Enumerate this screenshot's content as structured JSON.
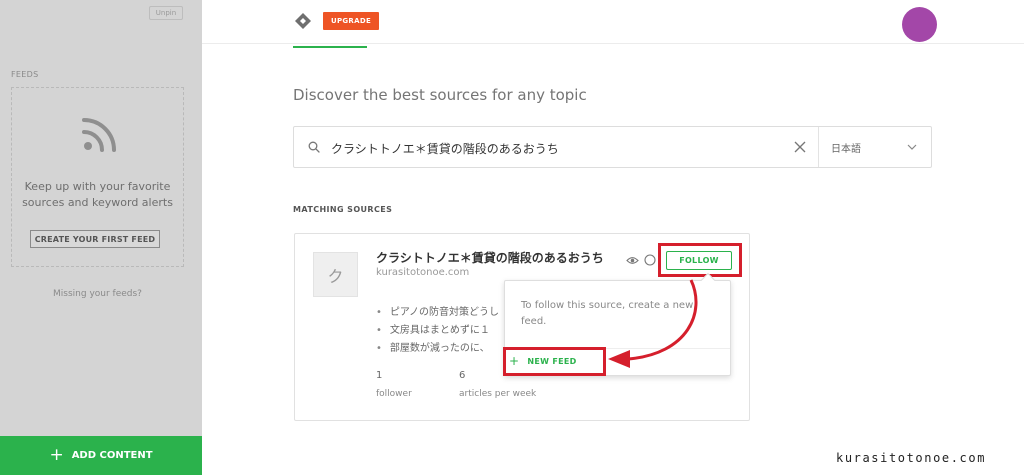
{
  "sidebar": {
    "unpin_label": "Unpin",
    "feeds_label": "FEEDS",
    "empty_message_line1": "Keep up with your favorite",
    "empty_message_line2": "sources and keyword alerts",
    "create_feed_label": "CREATE YOUR FIRST FEED",
    "missing_feeds_label": "Missing your feeds?",
    "add_content_label": "ADD CONTENT"
  },
  "header": {
    "upgrade_label": "UPGRADE"
  },
  "main": {
    "title": "Discover the best sources for any topic",
    "search": {
      "value": "クラシトトノエ＊賃貸の階段のあるおうち",
      "placeholder": ""
    },
    "language": "日本語",
    "matching_label": "MATCHING SOURCES"
  },
  "source": {
    "thumb_letter": "ク",
    "name": "クラシトトノエ＊賃貸の階段のあるおうち",
    "url": "kurasitotonoe.com",
    "follow_label": "FOLLOW",
    "articles": [
      "ピアノの防音対策どうし",
      "文房具はまとめずに１",
      "部屋数が減ったのに、"
    ],
    "followers_count": "1",
    "followers_label": "follower",
    "articles_count": "6",
    "articles_label": "articles per week"
  },
  "popover": {
    "message": "To follow this source, create a new feed.",
    "new_feed_label": "NEW FEED"
  },
  "watermark": "kurasitotonoe.com",
  "colors": {
    "accent_green": "#2bb24c",
    "upgrade_orange": "#ee5425",
    "highlight_red": "#d51f2c",
    "avatar_purple": "#a347a8"
  }
}
